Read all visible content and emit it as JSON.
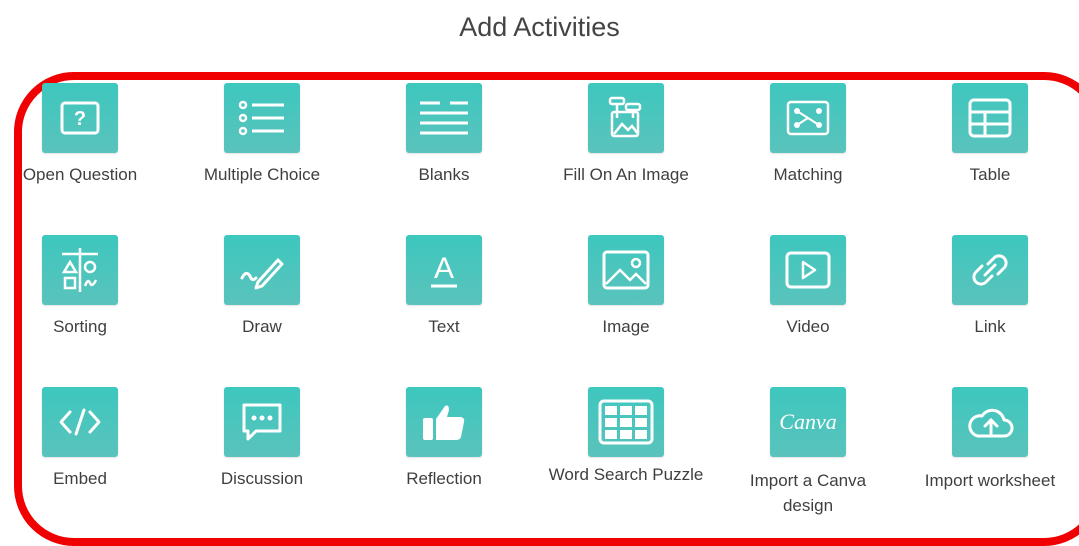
{
  "header": {
    "title": "Add Activities"
  },
  "activities": [
    {
      "label": "Open Question",
      "icon": "question-box-icon"
    },
    {
      "label": "Multiple Choice",
      "icon": "list-bullets-icon"
    },
    {
      "label": "Blanks",
      "icon": "lines-icon"
    },
    {
      "label": "Fill On An Image",
      "icon": "image-labels-icon"
    },
    {
      "label": "Matching",
      "icon": "matching-icon"
    },
    {
      "label": "Table",
      "icon": "table-icon"
    },
    {
      "label": "Sorting",
      "icon": "sorting-icon"
    },
    {
      "label": "Draw",
      "icon": "pencil-icon"
    },
    {
      "label": "Text",
      "icon": "text-a-icon"
    },
    {
      "label": "Image",
      "icon": "image-icon"
    },
    {
      "label": "Video",
      "icon": "video-play-icon"
    },
    {
      "label": "Link",
      "icon": "link-chain-icon"
    },
    {
      "label": "Embed",
      "icon": "code-icon"
    },
    {
      "label": "Discussion",
      "icon": "chat-bubble-icon"
    },
    {
      "label": "Reflection",
      "icon": "thumbs-up-icon"
    },
    {
      "label": "Word Search Puzzle",
      "icon": "grid-puzzle-icon"
    },
    {
      "label": "Import a Canva design",
      "icon": "canva-logo"
    },
    {
      "label": "Import worksheet",
      "icon": "cloud-upload-icon"
    }
  ],
  "logo_text": {
    "canva": "Canva"
  },
  "colors": {
    "tile": "#3fc6bd",
    "frame": "#f00000",
    "title": "#444444"
  }
}
